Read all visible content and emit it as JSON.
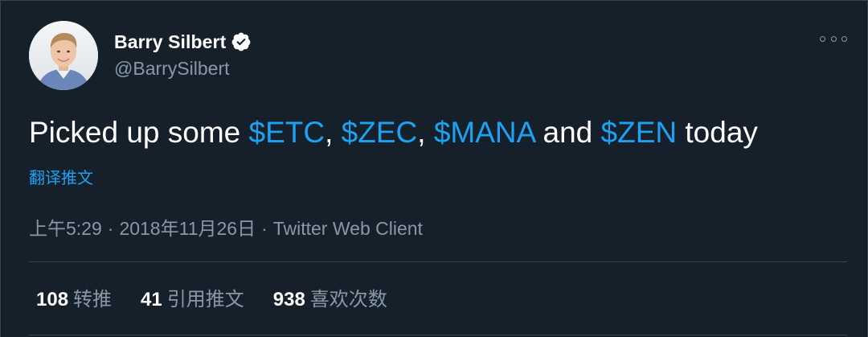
{
  "author": {
    "display_name": "Barry Silbert",
    "handle": "@BarrySilbert",
    "verified": true
  },
  "tweet": {
    "parts": [
      {
        "text": "Picked up some ",
        "type": "text"
      },
      {
        "text": "$ETC",
        "type": "cashtag"
      },
      {
        "text": ", ",
        "type": "text"
      },
      {
        "text": "$ZEC",
        "type": "cashtag"
      },
      {
        "text": ", ",
        "type": "text"
      },
      {
        "text": "$MANA",
        "type": "cashtag"
      },
      {
        "text": " and ",
        "type": "text"
      },
      {
        "text": "$ZEN",
        "type": "cashtag"
      },
      {
        "text": " today",
        "type": "text"
      }
    ],
    "translate_label": "翻译推文"
  },
  "meta": {
    "time": "上午5:29",
    "separator": "·",
    "date": "2018年11月26日",
    "source": "Twitter Web Client"
  },
  "stats": {
    "retweets": {
      "count": "108",
      "label": "转推"
    },
    "quotes": {
      "count": "41",
      "label": "引用推文"
    },
    "likes": {
      "count": "938",
      "label": "喜欢次数"
    }
  },
  "colors": {
    "background": "#15202b",
    "accent": "#1da1f2",
    "secondary_text": "#8899a6",
    "border": "#38444d"
  },
  "icons": {
    "verified": "verified-badge-icon",
    "more": "more-options-icon"
  }
}
